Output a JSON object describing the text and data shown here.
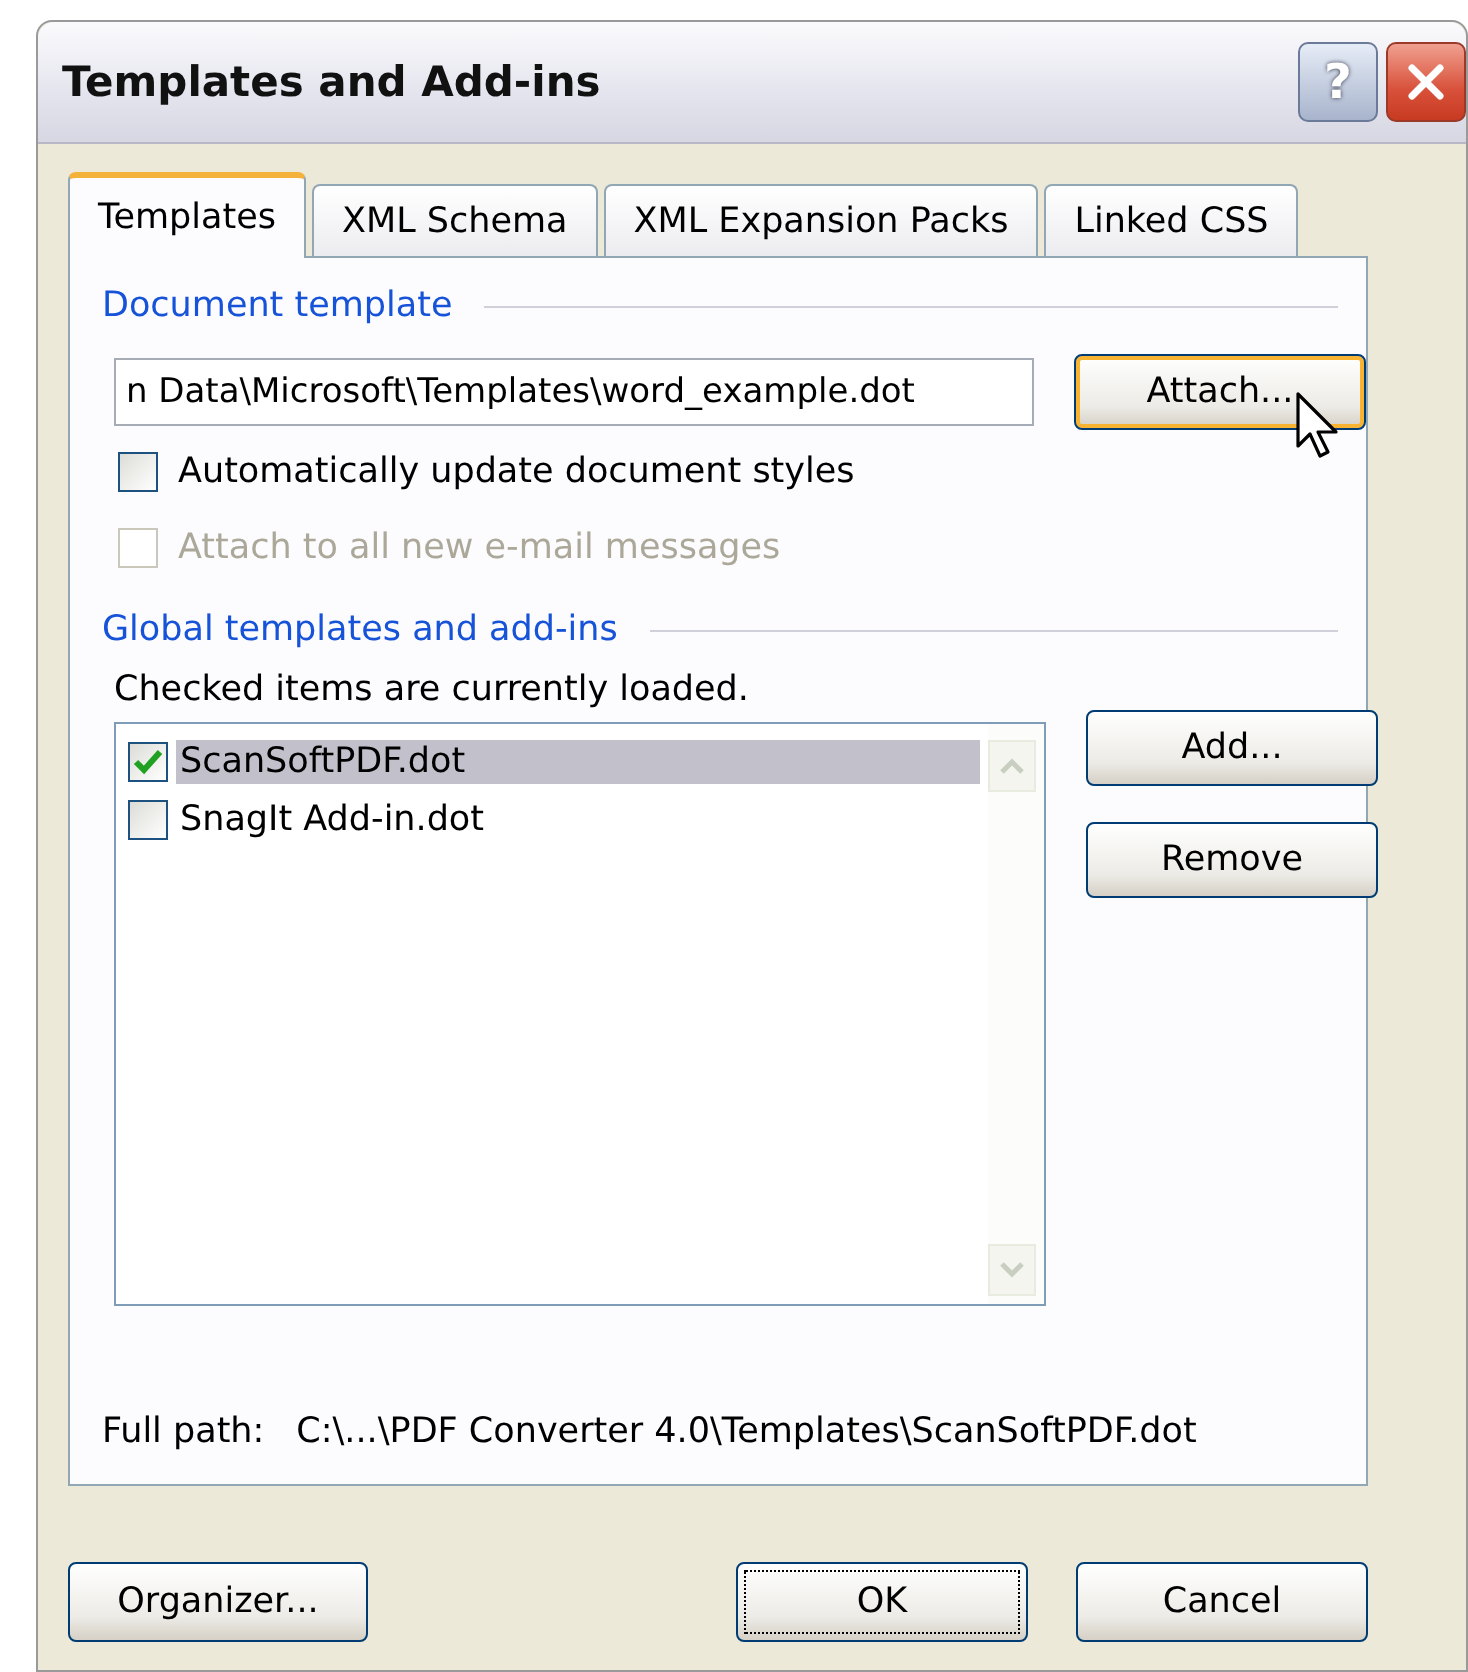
{
  "window": {
    "title": "Templates and Add-ins",
    "help_button": "?"
  },
  "tabs": [
    {
      "label": "Templates",
      "selected": true
    },
    {
      "label": "XML Schema",
      "selected": false
    },
    {
      "label": "XML Expansion Packs",
      "selected": false
    },
    {
      "label": "Linked CSS",
      "selected": false
    }
  ],
  "document_template": {
    "heading": "Document template",
    "path": "n Data\\Microsoft\\Templates\\word_example.dot",
    "attach_button": "Attach...",
    "options": [
      {
        "label": "Automatically update document styles",
        "checked": false,
        "disabled": false
      },
      {
        "label": "Attach to all new e-mail messages",
        "checked": false,
        "disabled": true
      }
    ]
  },
  "global_templates": {
    "heading": "Global templates and add-ins",
    "caption": "Checked items are currently loaded.",
    "items": [
      {
        "label": "ScanSoftPDF.dot",
        "checked": true,
        "selected": true
      },
      {
        "label": "SnagIt Add-in.dot",
        "checked": false,
        "selected": false
      }
    ],
    "buttons": [
      "Add...",
      "Remove"
    ],
    "full_path_label": "Full path:",
    "full_path": "C:\\...\\PDF Converter 4.0\\Templates\\ScanSoftPDF.dot"
  },
  "footer_buttons": [
    {
      "label": "Organizer...",
      "focused": false
    },
    {
      "label": "OK",
      "focused": true
    },
    {
      "label": "Cancel",
      "focused": false
    }
  ]
}
